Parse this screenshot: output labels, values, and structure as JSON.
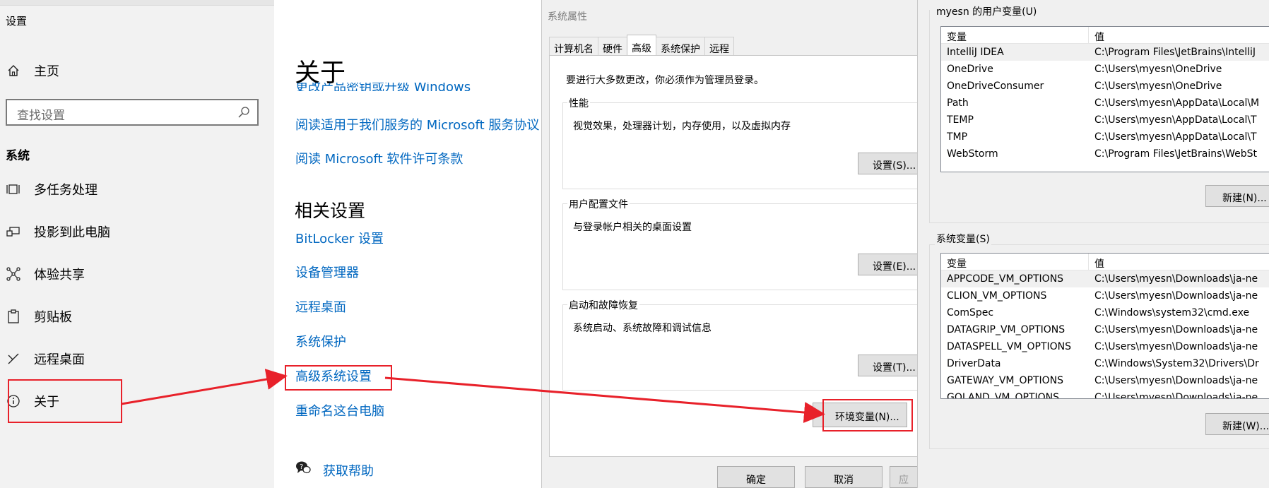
{
  "settings": {
    "window_title": "设置",
    "nav_home": "主页",
    "search_placeholder": "查找设置",
    "section_heading": "系统",
    "nav_items": [
      {
        "label": "多任务处理",
        "icon": "multitask-icon"
      },
      {
        "label": "投影到此电脑",
        "icon": "project-icon"
      },
      {
        "label": "体验共享",
        "icon": "share-icon"
      },
      {
        "label": "剪贴板",
        "icon": "clipboard-icon"
      },
      {
        "label": "远程桌面",
        "icon": "remote-desktop-icon"
      },
      {
        "label": "关于",
        "icon": "info-icon"
      }
    ]
  },
  "about": {
    "title": "关于",
    "partial_link": "更改产品密钥或升级 Windows",
    "links": [
      "阅读适用于我们服务的 Microsoft 服务协议",
      "阅读 Microsoft 软件许可条款"
    ],
    "related_title": "相关设置",
    "related_links": [
      "BitLocker 设置",
      "设备管理器",
      "远程桌面",
      "系统保护",
      "高级系统设置",
      "重命名这台电脑"
    ],
    "help_link": "获取帮助"
  },
  "system_properties": {
    "title": "系统属性",
    "tabs": [
      "计算机名",
      "硬件",
      "高级",
      "系统保护",
      "远程"
    ],
    "active_tab": "高级",
    "admin_note": "要进行大多数更改，你必须作为管理员登录。",
    "groups": [
      {
        "label": "性能",
        "desc": "视觉效果，处理器计划，内存使用，以及虚拟内存",
        "button": "设置(S)..."
      },
      {
        "label": "用户配置文件",
        "desc": "与登录帐户相关的桌面设置",
        "button": "设置(E)..."
      },
      {
        "label": "启动和故障恢复",
        "desc": "系统启动、系统故障和调试信息",
        "button": "设置(T)..."
      }
    ],
    "env_button": "环境变量(N)...",
    "ok": "确定",
    "cancel": "取消",
    "apply_partial": "应"
  },
  "env_vars": {
    "user_label": "myesn 的用户变量(U)",
    "col_var": "变量",
    "col_val": "值",
    "user_rows": [
      {
        "name": "IntelliJ IDEA",
        "value": "C:\\Program Files\\JetBrains\\IntelliJ"
      },
      {
        "name": "OneDrive",
        "value": "C:\\Users\\myesn\\OneDrive"
      },
      {
        "name": "OneDriveConsumer",
        "value": "C:\\Users\\myesn\\OneDrive"
      },
      {
        "name": "Path",
        "value": "C:\\Users\\myesn\\AppData\\Local\\M"
      },
      {
        "name": "TEMP",
        "value": "C:\\Users\\myesn\\AppData\\Local\\T"
      },
      {
        "name": "TMP",
        "value": "C:\\Users\\myesn\\AppData\\Local\\T"
      },
      {
        "name": "WebStorm",
        "value": "C:\\Program Files\\JetBrains\\WebSt"
      }
    ],
    "user_new": "新建(N)...",
    "system_label": "系统变量(S)",
    "system_rows": [
      {
        "name": "APPCODE_VM_OPTIONS",
        "value": "C:\\Users\\myesn\\Downloads\\ja-ne"
      },
      {
        "name": "CLION_VM_OPTIONS",
        "value": "C:\\Users\\myesn\\Downloads\\ja-ne"
      },
      {
        "name": "ComSpec",
        "value": "C:\\Windows\\system32\\cmd.exe"
      },
      {
        "name": "DATAGRIP_VM_OPTIONS",
        "value": "C:\\Users\\myesn\\Downloads\\ja-ne"
      },
      {
        "name": "DATASPELL_VM_OPTIONS",
        "value": "C:\\Users\\myesn\\Downloads\\ja-ne"
      },
      {
        "name": "DriverData",
        "value": "C:\\Windows\\System32\\Drivers\\Dr"
      },
      {
        "name": "GATEWAY_VM_OPTIONS",
        "value": "C:\\Users\\myesn\\Downloads\\ja-ne"
      },
      {
        "name": "GOLAND_VM_OPTIONS",
        "value": "C:\\Users\\myesn\\Downloads\\ja-ne"
      }
    ],
    "system_new": "新建(W)..."
  },
  "annotation_color": "#e8212a",
  "link_color": "#0067c0"
}
